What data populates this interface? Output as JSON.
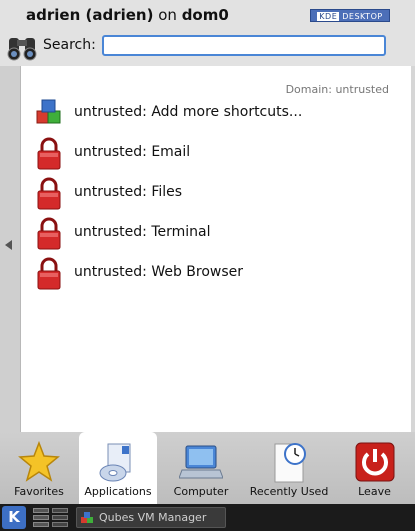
{
  "header": {
    "user_name": "adrien (adrien)",
    "on_text": "on",
    "host": "dom0",
    "badge_k": "KDE",
    "badge_text": "DESKTOP",
    "search_label": "Search:",
    "search_value": "",
    "search_placeholder": ""
  },
  "list": {
    "domain_label": "Domain: untrusted",
    "items": [
      {
        "label": "untrusted: Add more shortcuts...",
        "icon": "add-shortcuts-icon"
      },
      {
        "label": "untrusted: Email",
        "icon": "red-lock-icon"
      },
      {
        "label": "untrusted: Files",
        "icon": "red-lock-icon"
      },
      {
        "label": "untrusted: Terminal",
        "icon": "red-lock-icon"
      },
      {
        "label": "untrusted: Web Browser",
        "icon": "red-lock-icon"
      }
    ]
  },
  "tabs": [
    {
      "label": "Favorites",
      "icon": "star-icon"
    },
    {
      "label": "Applications",
      "icon": "applications-icon"
    },
    {
      "label": "Computer",
      "icon": "laptop-icon"
    },
    {
      "label": "Recently Used",
      "icon": "clock-document-icon"
    },
    {
      "label": "Leave",
      "icon": "power-icon"
    }
  ],
  "active_tab": "Applications",
  "taskbar": {
    "kmenu_label": "K",
    "task_label": "Qubes VM Manager"
  },
  "colors": {
    "accent": "#4a86d6",
    "lock_red": "#d42a2a",
    "leave_red": "#c8211b"
  }
}
